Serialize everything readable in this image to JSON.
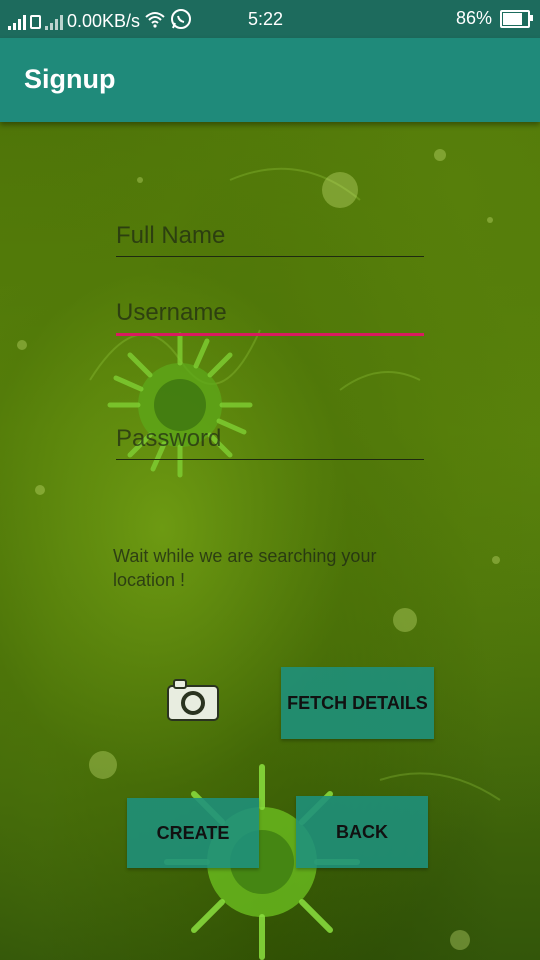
{
  "status_bar": {
    "network_speed": "0.00KB/s",
    "time": "5:22",
    "battery_percent": "86%",
    "battery_level": 0.86
  },
  "app_bar": {
    "title": "Signup"
  },
  "form": {
    "full_name": {
      "placeholder": "Full Name",
      "value": ""
    },
    "username": {
      "placeholder": "Username",
      "value": ""
    },
    "password": {
      "placeholder": "Password",
      "value": ""
    }
  },
  "location_status": "Wait while we are searching your location !",
  "buttons": {
    "fetch_details": "FETCH DETAILS",
    "create": "CREATE",
    "back": "BACK"
  },
  "icons": {
    "camera": "camera-icon",
    "whatsapp": "whatsapp-icon",
    "wifi": "wifi-icon",
    "battery": "battery-icon"
  },
  "colors": {
    "status_bar": "#1d6b5d",
    "app_bar": "#1f8a7a",
    "button": "#1e917d",
    "focus_underline": "#d81b60"
  }
}
